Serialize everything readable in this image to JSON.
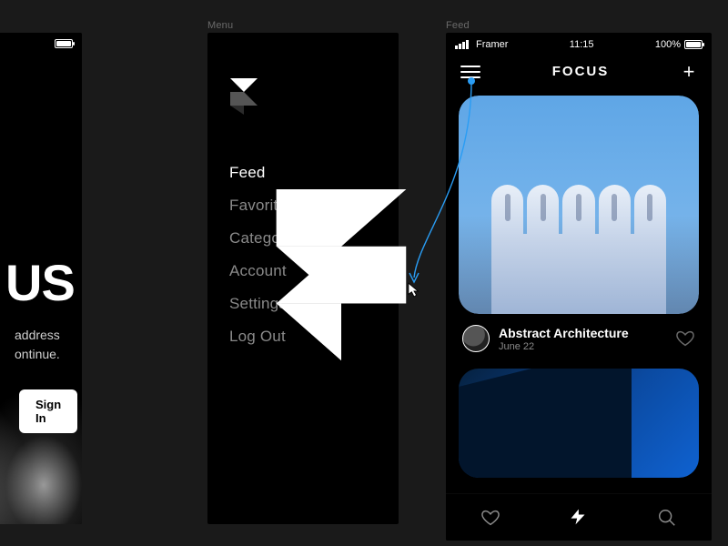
{
  "canvas": {
    "frame_labels": {
      "menu": "Menu",
      "feed": "Feed"
    }
  },
  "signin": {
    "status_battery": "100%",
    "title_fragment": "US",
    "sub_line1": "address",
    "sub_line2": "ontinue.",
    "button": "Sign In"
  },
  "menu": {
    "items": [
      {
        "label": "Feed",
        "active": true
      },
      {
        "label": "Favorites",
        "active": false
      },
      {
        "label": "Categories",
        "active": false
      },
      {
        "label": "Account",
        "active": false
      },
      {
        "label": "Settings",
        "active": false
      },
      {
        "label": "Log Out",
        "active": false
      }
    ]
  },
  "feed": {
    "status": {
      "carrier": "Framer",
      "time": "11:15",
      "battery": "100%"
    },
    "header_title": "FOCUS",
    "card1": {
      "title": "Abstract Architecture",
      "date": "June 22"
    }
  },
  "colors": {
    "bg": "#1a1a1a",
    "panel": "#000000",
    "muted": "#8a8a8a",
    "link": "#2a7fff"
  }
}
